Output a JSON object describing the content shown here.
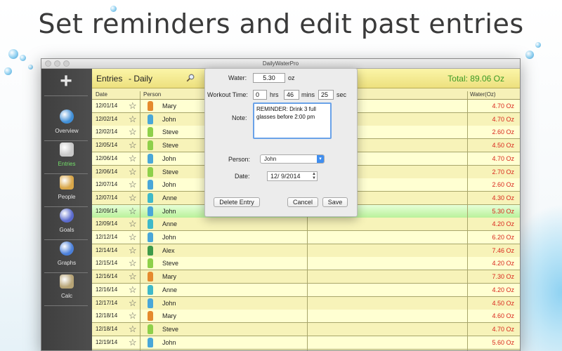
{
  "headline": "Set reminders and edit past entries",
  "window": {
    "title": "DailyWaterPro"
  },
  "sidebar": {
    "add_label": "+",
    "items": [
      {
        "label": "Overview",
        "icon": "globe-icon",
        "color": "#3f8ed6"
      },
      {
        "label": "Entries",
        "icon": "scale-icon",
        "color": "#c9c9c9",
        "active": true
      },
      {
        "label": "People",
        "icon": "weightlifter-icon",
        "color": "#d9a74a"
      },
      {
        "label": "Goals",
        "icon": "target-icon",
        "color": "#5a6acd"
      },
      {
        "label": "Graphs",
        "icon": "pie-chart-icon",
        "color": "#4a7fd9"
      },
      {
        "label": "Calc",
        "icon": "calculator-icon",
        "color": "#b7a476"
      }
    ]
  },
  "header": {
    "title": "Entries",
    "subtitle": "- Daily",
    "total": "Total: 89.06 Oz"
  },
  "columns": {
    "date": "Date",
    "person": "Person",
    "water": "Water(Oz)"
  },
  "rows": [
    {
      "date": "12/01/14",
      "person": "Mary",
      "water": "4.70 Oz",
      "icon_color": "#e58a2e"
    },
    {
      "date": "12/02/14",
      "person": "John",
      "water": "4.70 Oz",
      "icon_color": "#4aa7d8"
    },
    {
      "date": "12/02/14",
      "person": "Steve",
      "water": "2.60 Oz",
      "icon_color": "#8ed04a"
    },
    {
      "date": "12/05/14",
      "person": "Steve",
      "water": "4.50 Oz",
      "icon_color": "#8ed04a"
    },
    {
      "date": "12/06/14",
      "person": "John",
      "water": "4.70 Oz",
      "icon_color": "#4aa7d8"
    },
    {
      "date": "12/06/14",
      "person": "Steve",
      "water": "2.70 Oz",
      "icon_color": "#8ed04a"
    },
    {
      "date": "12/07/14",
      "person": "John",
      "water": "2.60 Oz",
      "icon_color": "#4aa7d8"
    },
    {
      "date": "12/07/14",
      "person": "Anne",
      "water": "4.30 Oz",
      "icon_color": "#3fb9c9"
    },
    {
      "date": "12/09/14",
      "person": "John",
      "water": "5.30 Oz",
      "icon_color": "#4aa7d8",
      "selected": true
    },
    {
      "date": "12/09/14",
      "person": "Anne",
      "water": "4.20 Oz",
      "icon_color": "#3fb9c9"
    },
    {
      "date": "12/12/14",
      "person": "John",
      "water": "6.20 Oz",
      "icon_color": "#4aa7d8"
    },
    {
      "date": "12/14/14",
      "person": "Alex",
      "water": "7.46 Oz",
      "icon_color": "#3f9a4a"
    },
    {
      "date": "12/15/14",
      "person": "Steve",
      "water": "4.20 Oz",
      "icon_color": "#8ed04a"
    },
    {
      "date": "12/16/14",
      "person": "Mary",
      "water": "7.30 Oz",
      "icon_color": "#e58a2e"
    },
    {
      "date": "12/16/14",
      "person": "Anne",
      "water": "4.20 Oz",
      "icon_color": "#3fb9c9"
    },
    {
      "date": "12/17/14",
      "person": "John",
      "water": "4.50 Oz",
      "icon_color": "#4aa7d8"
    },
    {
      "date": "12/18/14",
      "person": "Mary",
      "water": "4.60 Oz",
      "icon_color": "#e58a2e"
    },
    {
      "date": "12/18/14",
      "person": "Steve",
      "water": "4.70 Oz",
      "icon_color": "#8ed04a"
    },
    {
      "date": "12/19/14",
      "person": "John",
      "water": "5.60 Oz",
      "icon_color": "#4aa7d8"
    }
  ],
  "editor": {
    "water_label": "Water:",
    "water_value": "5.30",
    "water_unit": "oz",
    "workout_label": "Workout Time:",
    "hrs_value": "0",
    "hrs_unit": "hrs",
    "mins_value": "46",
    "mins_unit": "mins",
    "secs_value": "25",
    "secs_unit": "sec",
    "note_label": "Note:",
    "note_value": "REMINDER: Drink 3 full glasses before 2:00 pm",
    "person_label": "Person:",
    "person_value": "John",
    "date_label": "Date:",
    "date_value": "12/ 9/2014",
    "delete_label": "Delete Entry",
    "cancel_label": "Cancel",
    "save_label": "Save"
  }
}
